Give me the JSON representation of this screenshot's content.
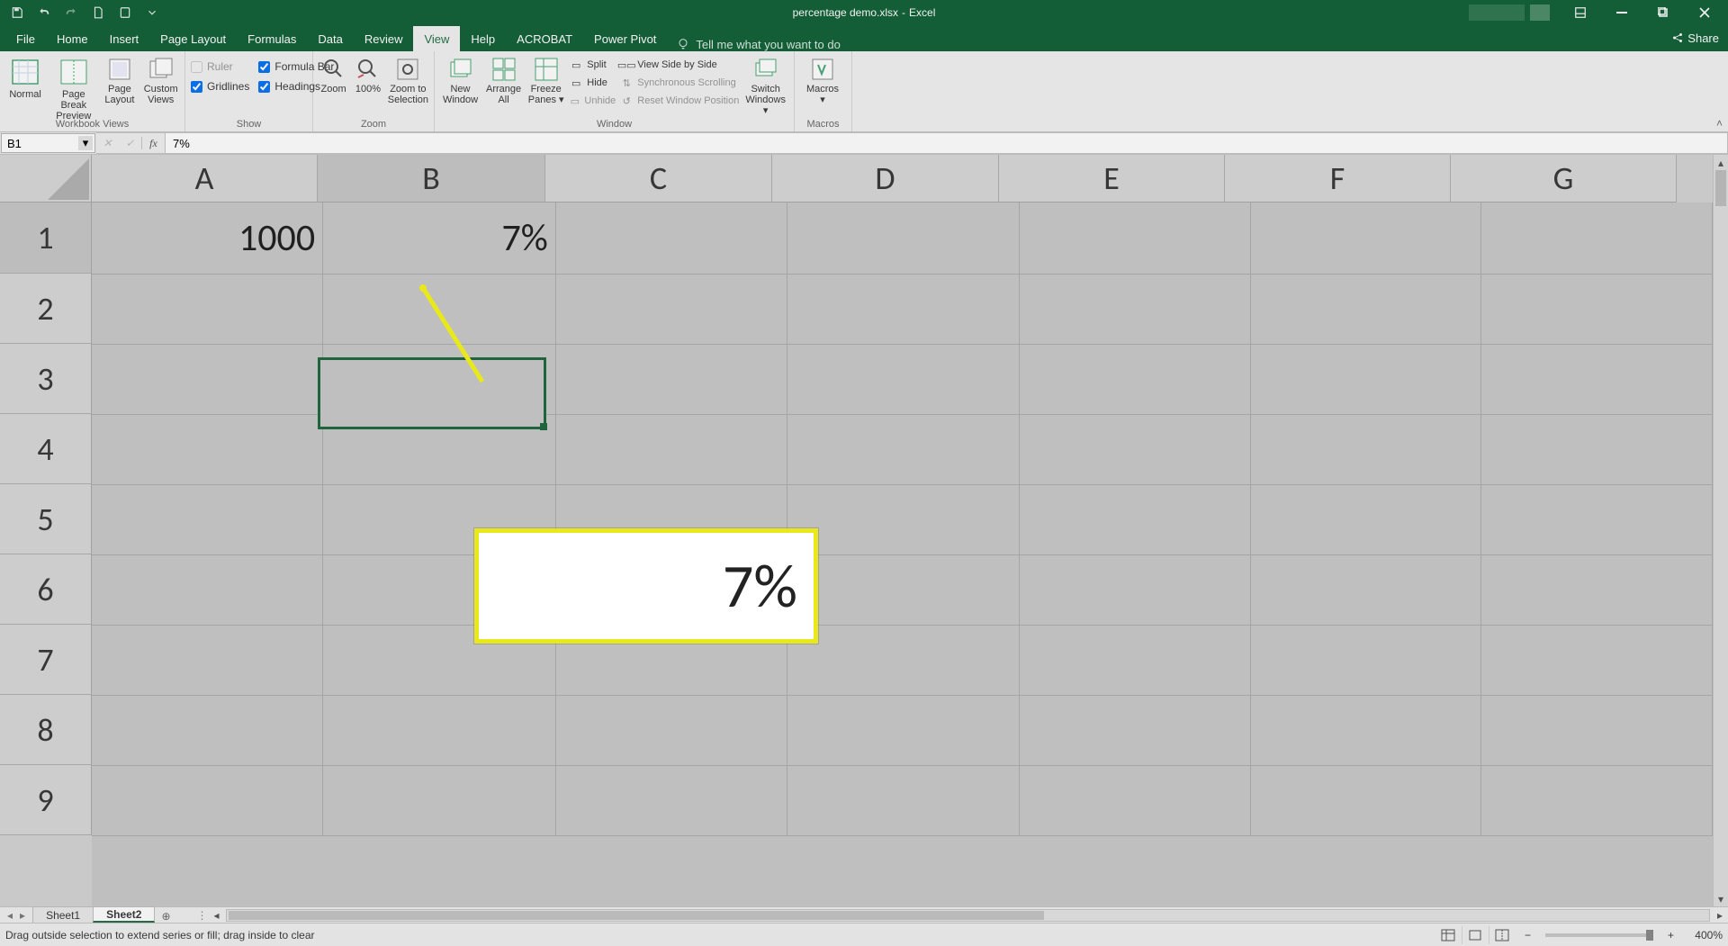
{
  "title": {
    "filename": "percentage demo.xlsx",
    "app": "Excel"
  },
  "qat": {
    "save": "Save",
    "undo": "Undo",
    "redo": "Redo",
    "new": "New",
    "touch": "Touch/Mouse Mode",
    "customize": "Customize Quick Access Toolbar"
  },
  "wincontrols": {
    "ribbon_opts": "Ribbon Display Options",
    "minimize": "Minimize",
    "restore": "Restore Down",
    "close": "Close"
  },
  "tabs": {
    "file": "File",
    "home": "Home",
    "insert": "Insert",
    "page_layout": "Page Layout",
    "formulas": "Formulas",
    "data": "Data",
    "review": "Review",
    "view": "View",
    "help": "Help",
    "acrobat": "ACROBAT",
    "power_pivot": "Power Pivot",
    "tell_me": "Tell me what you want to do",
    "share": "Share"
  },
  "ribbon": {
    "views": {
      "normal": "Normal",
      "page_break": "Page Break Preview",
      "page_layout_btn": "Page Layout",
      "custom_views": "Custom Views",
      "group": "Workbook Views"
    },
    "show": {
      "ruler": "Ruler",
      "formula_bar": "Formula Bar",
      "gridlines": "Gridlines",
      "headings": "Headings",
      "group": "Show"
    },
    "zoom": {
      "zoom": "Zoom",
      "p100": "100%",
      "to_sel": "Zoom to Selection",
      "group": "Zoom"
    },
    "window": {
      "new_window": "New Window",
      "arrange_all": "Arrange All",
      "freeze_panes": "Freeze Panes",
      "split": "Split",
      "hide": "Hide",
      "unhide": "Unhide",
      "side_by_side": "View Side by Side",
      "sync_scroll": "Synchronous Scrolling",
      "reset_pos": "Reset Window Position",
      "switch_windows": "Switch Windows",
      "group": "Window"
    },
    "macros": {
      "macros": "Macros",
      "group": "Macros"
    }
  },
  "formula_bar": {
    "name_box": "B1",
    "cancel": "Cancel",
    "enter": "Enter",
    "fx": "fx",
    "value": "7%"
  },
  "sheet": {
    "columns": [
      "A",
      "B",
      "C",
      "D",
      "E",
      "F",
      "G"
    ],
    "rows": [
      "1",
      "2",
      "3",
      "4",
      "5",
      "6",
      "7",
      "8",
      "9"
    ],
    "cells": {
      "A1": "1000",
      "B1": "7%"
    },
    "selected_cell": "B1"
  },
  "callout": {
    "text": "7%"
  },
  "tabs_bar": {
    "sheet1": "Sheet1",
    "sheet2": "Sheet2",
    "new_sheet_tip": "New sheet",
    "prev": "Previous sheet",
    "next": "Next sheet"
  },
  "status": {
    "message": "Drag outside selection to extend series or fill; drag inside to clear",
    "views": {
      "normal": "Normal",
      "page_layout": "Page Layout",
      "page_break": "Page Break Preview"
    },
    "zoom_label": "400%"
  }
}
